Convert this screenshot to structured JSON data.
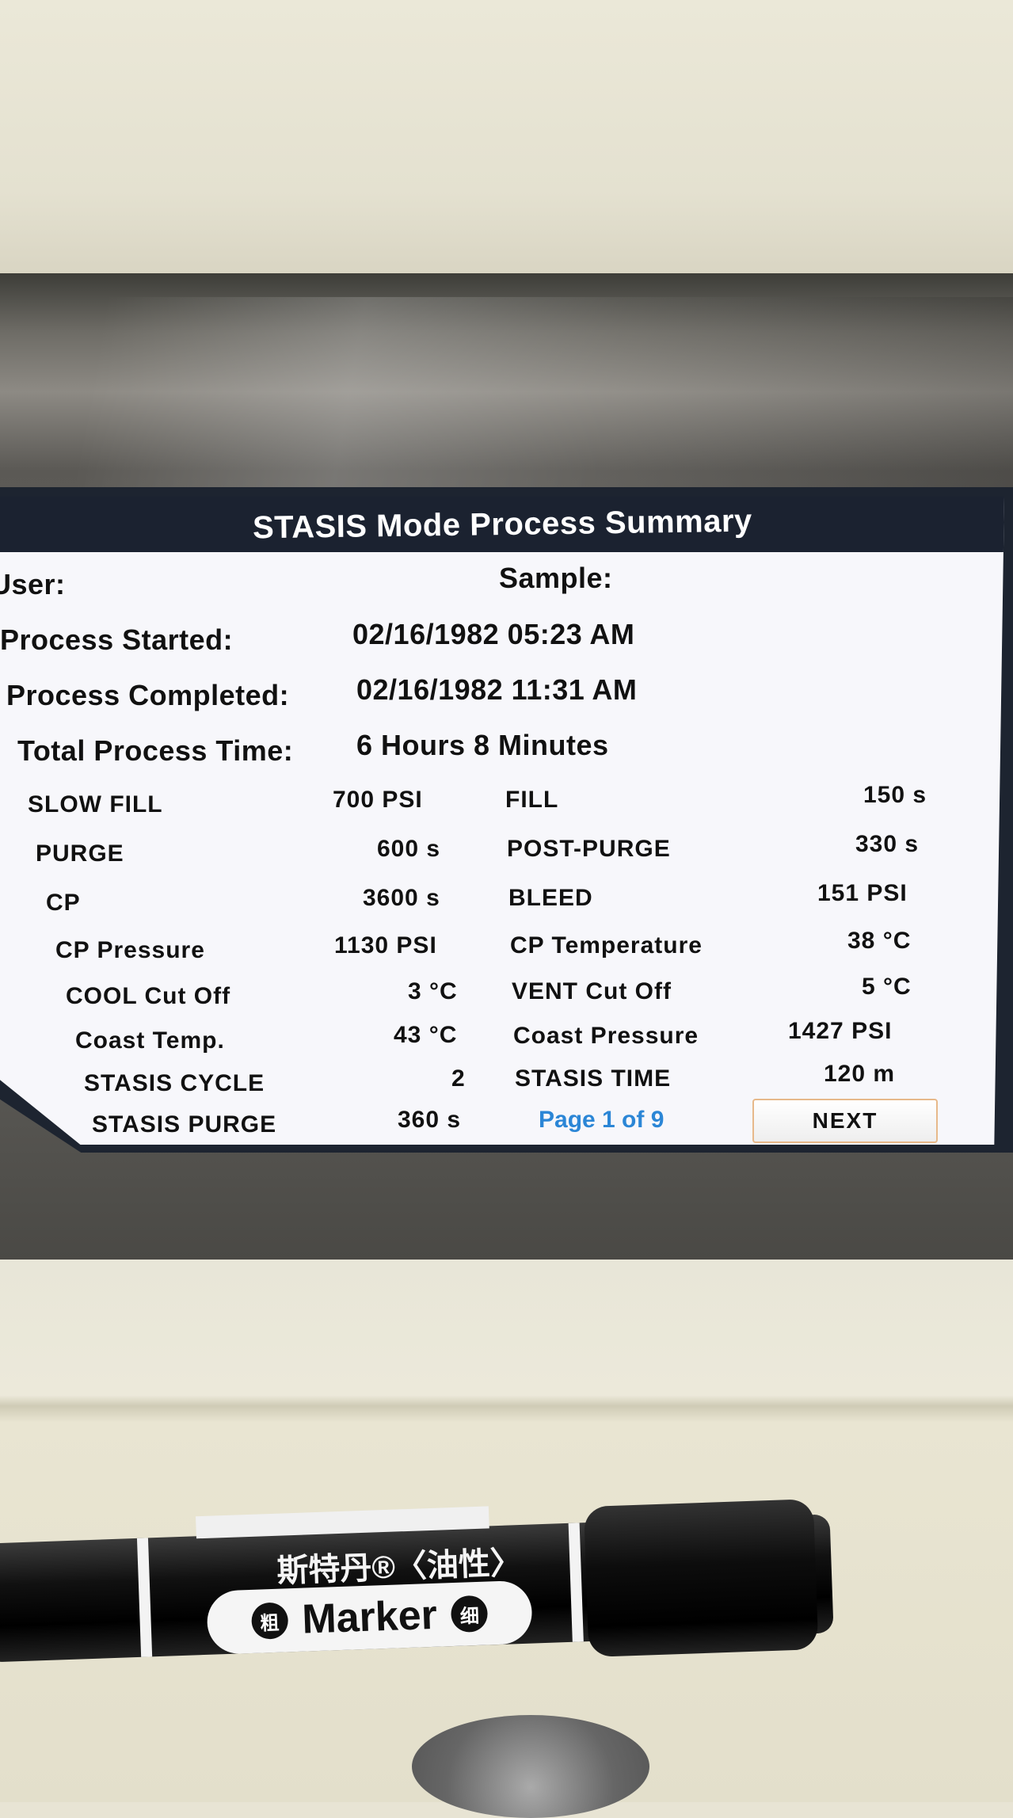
{
  "screen": {
    "title": "STASIS Mode Process Summary",
    "user_label": "User:",
    "sample_label": "Sample:",
    "process_started_label": "Process Started:",
    "process_started_value": "02/16/1982 05:23 AM",
    "process_completed_label": "Process Completed:",
    "process_completed_value": "02/16/1982 11:31 AM",
    "total_time_label": "Total Process Time:",
    "total_time_value": "6  Hours 8 Minutes",
    "params_left": [
      {
        "label": "SLOW FILL",
        "value": "700 PSI"
      },
      {
        "label": "PURGE",
        "value": "600 s"
      },
      {
        "label": "CP",
        "value": "3600 s"
      },
      {
        "label": "CP Pressure",
        "value": "1130 PSI"
      },
      {
        "label": "COOL Cut Off",
        "value": "3 °C"
      },
      {
        "label": "Coast Temp.",
        "value": "43 °C"
      },
      {
        "label": "STASIS CYCLE",
        "value": "2"
      },
      {
        "label": "STASIS PURGE",
        "value": "360 s"
      }
    ],
    "params_right": [
      {
        "label": "FILL",
        "value": "150 s"
      },
      {
        "label": "POST-PURGE",
        "value": "330 s"
      },
      {
        "label": "BLEED",
        "value": "151 PSI"
      },
      {
        "label": "CP Temperature",
        "value": "38 °C"
      },
      {
        "label": "VENT Cut Off",
        "value": "5 °C"
      },
      {
        "label": "Coast Pressure",
        "value": "1427 PSI"
      },
      {
        "label": "STASIS TIME",
        "value": "120 m"
      }
    ],
    "page_indicator": "Page 1 of 9",
    "next_label": "NEXT"
  },
  "marker": {
    "brand_cn": "斯特丹®〈油性〉",
    "brand_word": "Marker",
    "left_badge": "粗",
    "right_badge": "细"
  },
  "colors": {
    "title_bar": "#1b2230",
    "screen_bg": "#f7f7fb",
    "page_indicator": "#2b86d6",
    "next_border": "#e7b98a"
  }
}
